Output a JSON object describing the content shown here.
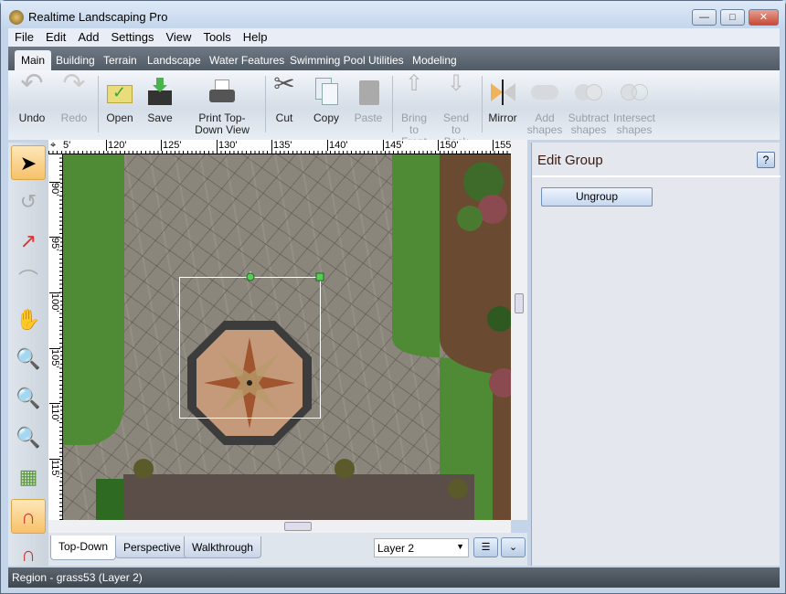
{
  "window": {
    "title": "Realtime Landscaping Pro",
    "controls": [
      "minimize",
      "maximize",
      "close"
    ]
  },
  "menu": [
    "File",
    "Edit",
    "Add",
    "Settings",
    "View",
    "Tools",
    "Help"
  ],
  "ribbon_tabs": [
    "Main",
    "Building",
    "Terrain",
    "Landscape",
    "Water Features",
    "Swimming Pool",
    "Utilities",
    "Modeling"
  ],
  "active_tab": "Main",
  "ribbon": {
    "undo": "Undo",
    "redo": "Redo",
    "open": "Open",
    "save": "Save",
    "print": "Print Top-Down View",
    "cut": "Cut",
    "copy": "Copy",
    "paste": "Paste",
    "bring_front": "Bring to Front",
    "send_back": "Send to Back",
    "mirror": "Mirror",
    "add_shapes": "Add shapes",
    "subtract_shapes": "Subtract shapes",
    "intersect_shapes": "Intersect shapes"
  },
  "tools": [
    "select-arrow",
    "rotate",
    "resize",
    "arc",
    "pan-hand",
    "zoom",
    "zoom-region",
    "zoom-extents",
    "grid",
    "snap-magnet",
    "snap-magnet-small"
  ],
  "ruler": {
    "top": [
      "5'",
      "120'",
      "125'",
      "130'",
      "135'",
      "140'",
      "145'",
      "150'",
      "155'"
    ],
    "left": [
      "90'",
      "95'",
      "100'",
      "105'",
      "110'",
      "115'"
    ]
  },
  "view_tabs": [
    "Top-Down",
    "Perspective",
    "Walkthrough"
  ],
  "active_view": "Top-Down",
  "layer_select": "Layer 2",
  "panel": {
    "title": "Edit Group",
    "help": "?",
    "ungroup": "Ungroup"
  },
  "status": "Region - grass53 (Layer 2)",
  "colors": {
    "grass": "#4f8a34",
    "stone": "#8a867c",
    "selected_tool": "#f7c16a"
  }
}
